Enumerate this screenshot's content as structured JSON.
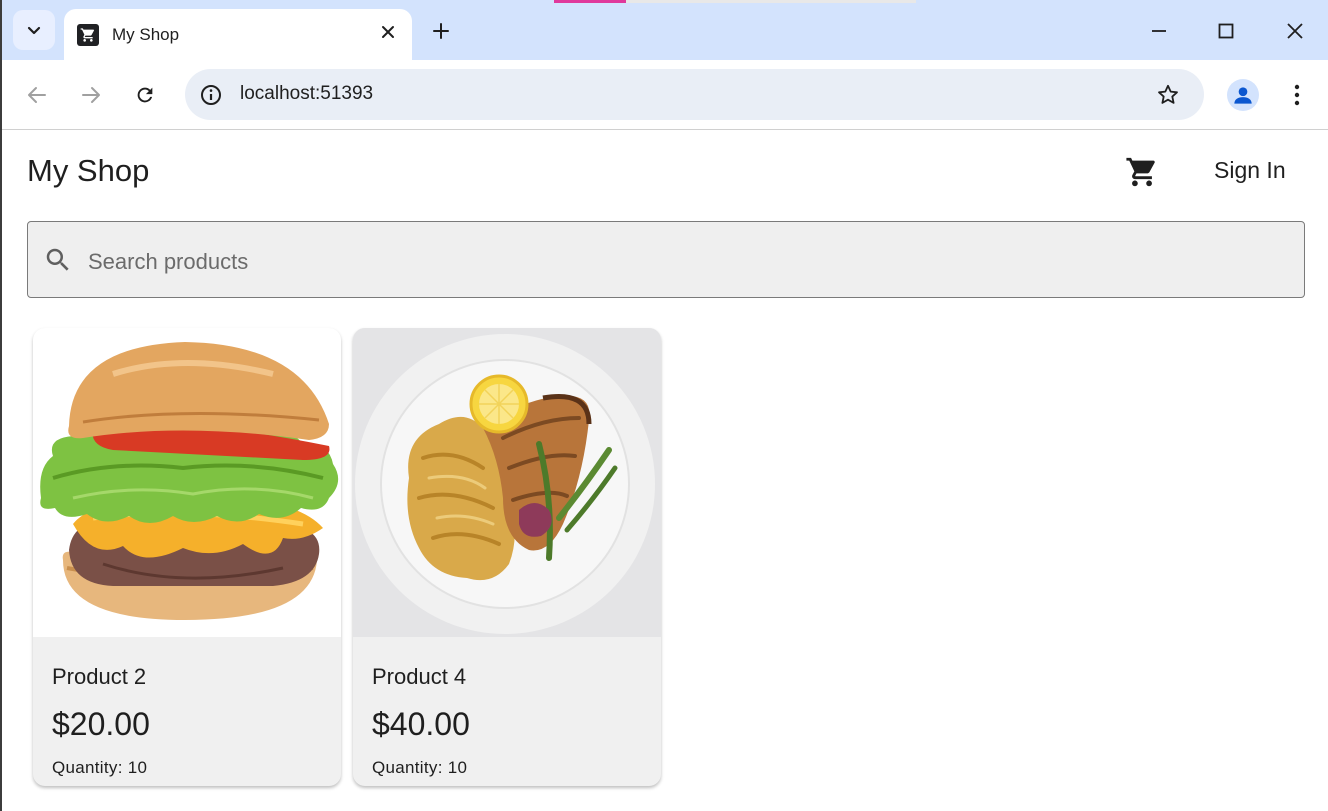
{
  "browser": {
    "tab": {
      "title": "My Shop"
    },
    "address_bar": {
      "url": "localhost:51393"
    }
  },
  "app": {
    "title": "My Shop",
    "header": {
      "sign_in_label": "Sign In",
      "cart_icon": "shopping-cart-icon"
    },
    "search": {
      "placeholder": "Search products",
      "value": ""
    },
    "products": [
      {
        "name": "Product 2",
        "price": "$20.00",
        "quantity_label": "Quantity:",
        "quantity": "10",
        "image": "burger"
      },
      {
        "name": "Product 4",
        "price": "$40.00",
        "quantity_label": "Quantity:",
        "quantity": "10",
        "image": "fish-rice-plate"
      }
    ]
  },
  "colors": {
    "tabstrip": "#d3e3fd",
    "omnibox": "#e9eef6",
    "card_bg": "#f0f0f0",
    "search_bg": "#efefef"
  }
}
